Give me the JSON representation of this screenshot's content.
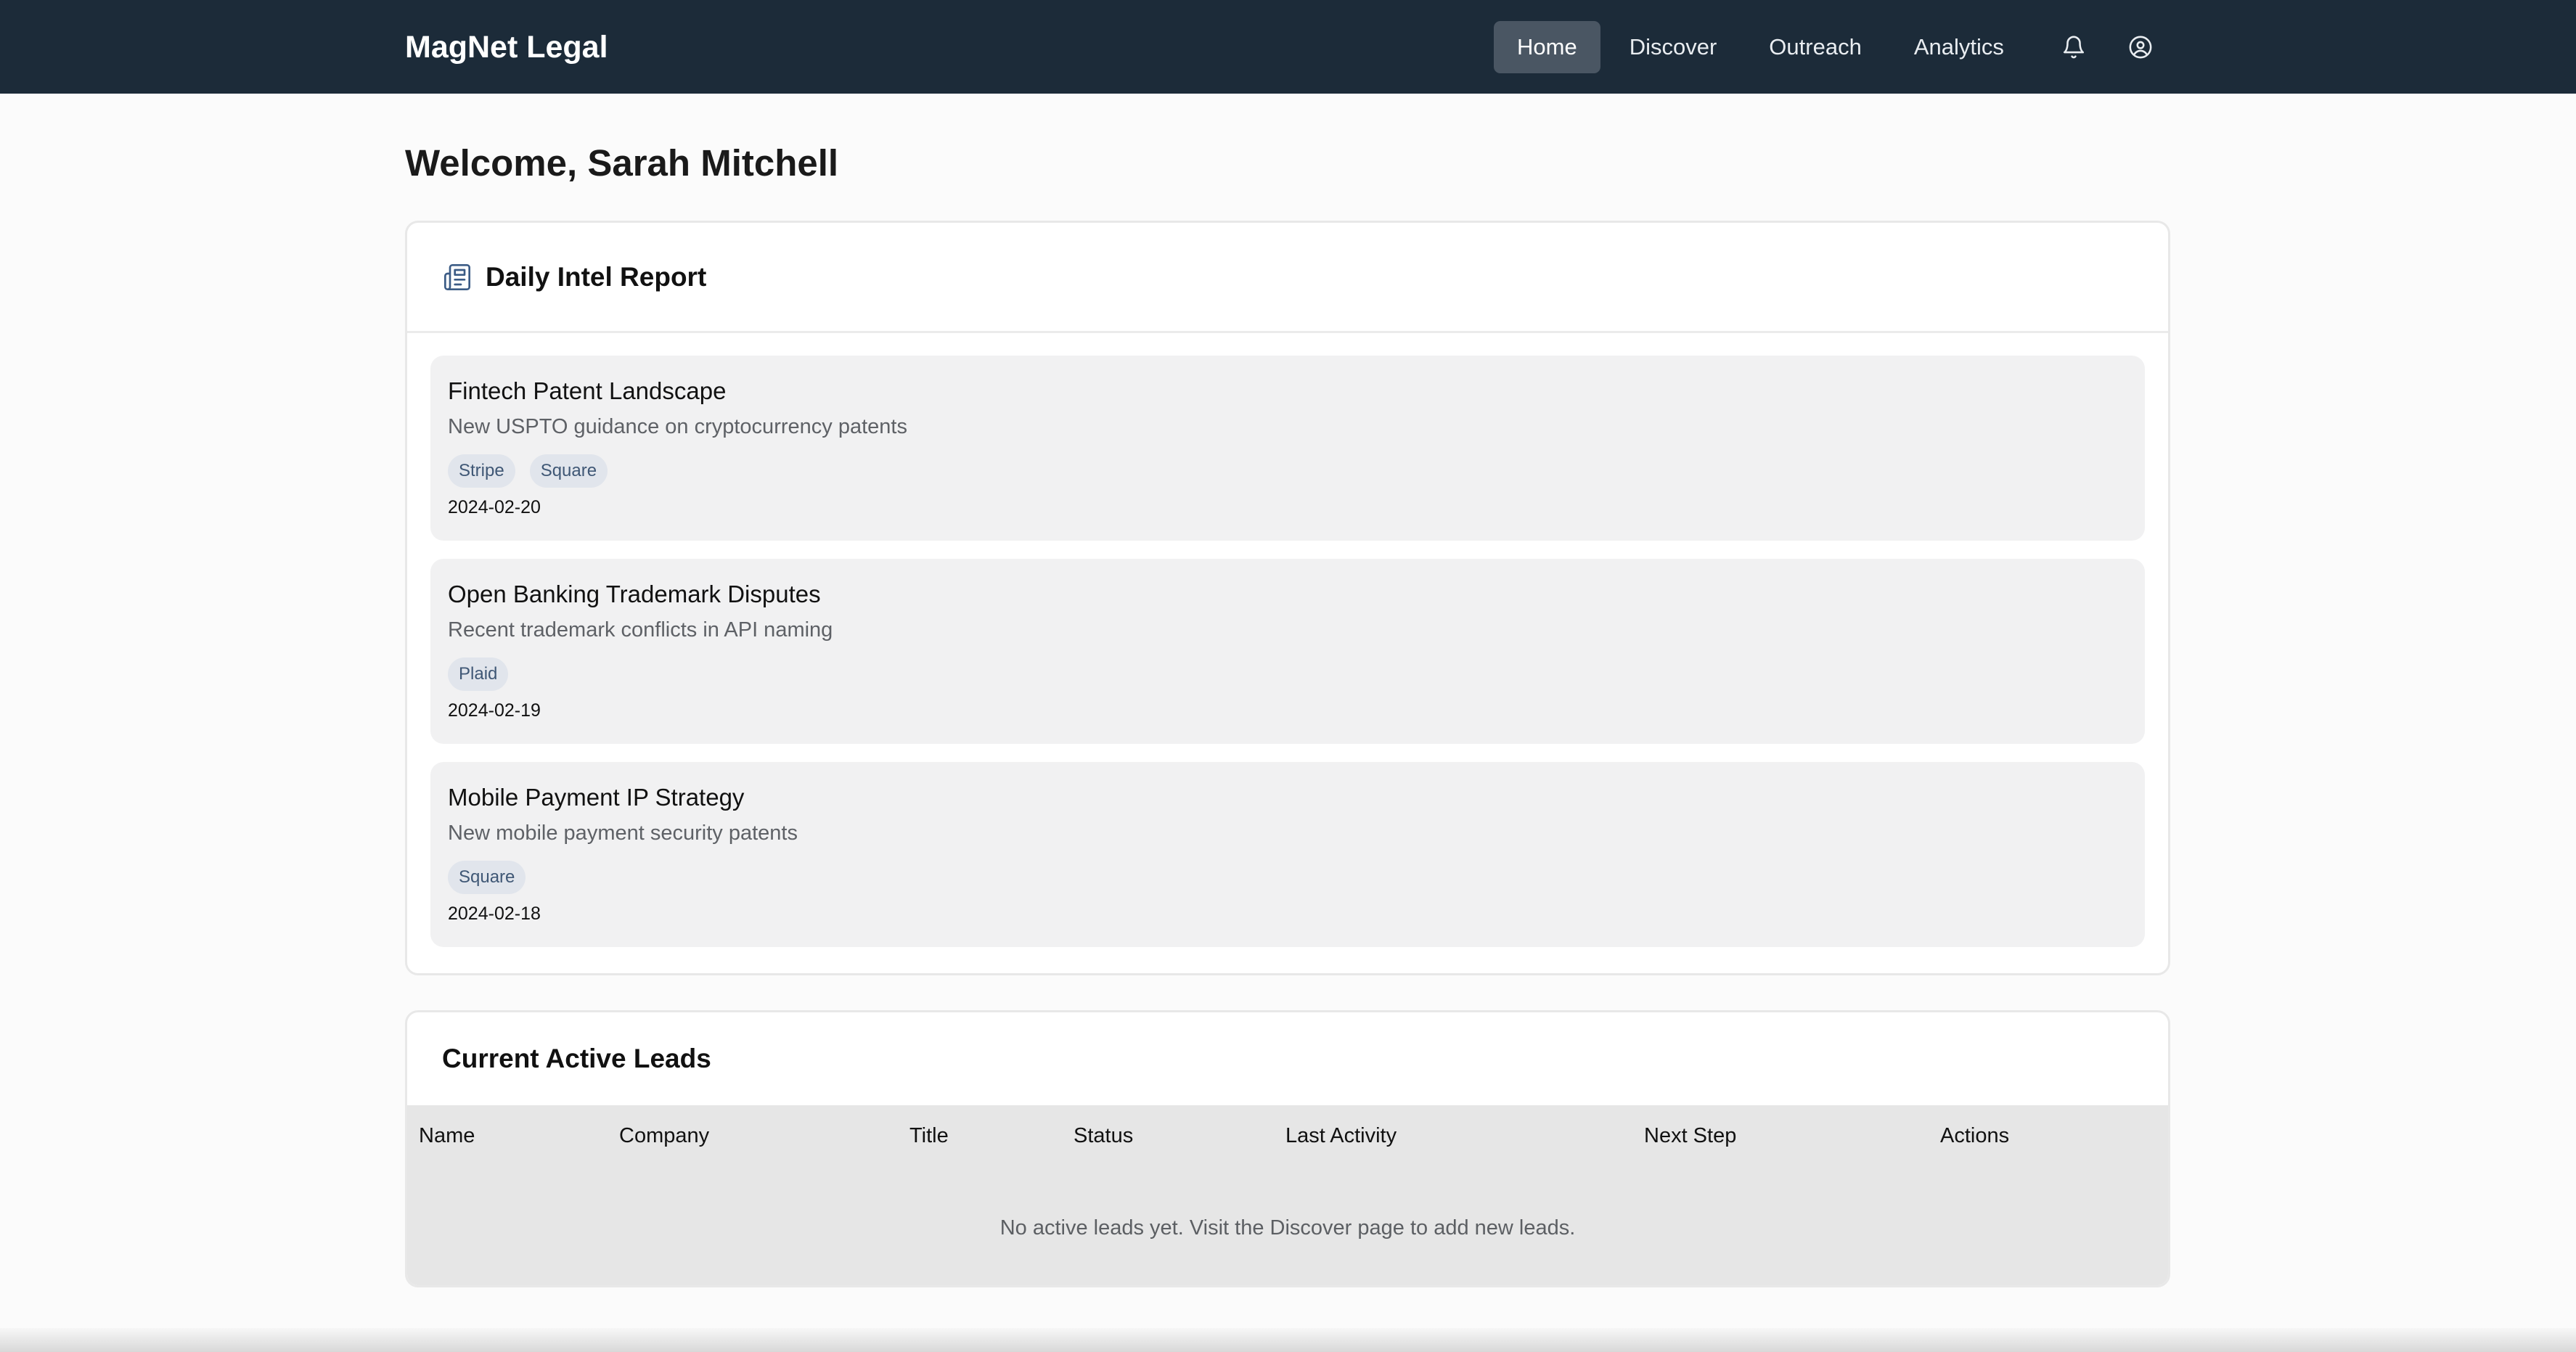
{
  "app": {
    "brand": "MagNet Legal"
  },
  "nav": {
    "items": [
      {
        "label": "Home",
        "active": true
      },
      {
        "label": "Discover",
        "active": false
      },
      {
        "label": "Outreach",
        "active": false
      },
      {
        "label": "Analytics",
        "active": false
      }
    ],
    "icons": [
      "bell-icon",
      "user-circle-icon"
    ]
  },
  "page": {
    "title": "Welcome, Sarah Mitchell"
  },
  "intel": {
    "title": "Daily Intel Report",
    "icon": "newspaper-icon",
    "reports": [
      {
        "title": "Fintech Patent Landscape",
        "description": "New USPTO guidance on cryptocurrency patents",
        "tags": [
          "Stripe",
          "Square"
        ],
        "date": "2024-02-20"
      },
      {
        "title": "Open Banking Trademark Disputes",
        "description": "Recent trademark conflicts in API naming",
        "tags": [
          "Plaid"
        ],
        "date": "2024-02-19"
      },
      {
        "title": "Mobile Payment IP Strategy",
        "description": "New mobile payment security patents",
        "tags": [
          "Square"
        ],
        "date": "2024-02-18"
      }
    ]
  },
  "leads": {
    "title": "Current Active Leads",
    "columns": [
      "Name",
      "Company",
      "Title",
      "Status",
      "Last Activity",
      "Next Step",
      "Actions"
    ],
    "empty_message": "No active leads yet. Visit the Discover page to add new leads."
  },
  "colors": {
    "topbar": "#1c2b39",
    "nav_active": "#4a5663",
    "tag_bg": "#e1e5ec",
    "tag_text": "#3f5775",
    "report_bg": "#f1f1f2"
  }
}
